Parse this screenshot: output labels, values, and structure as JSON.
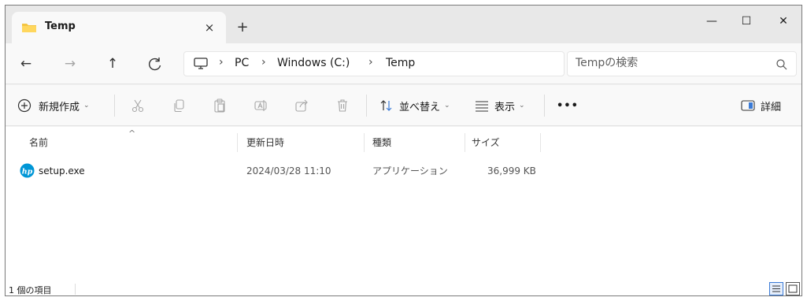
{
  "tab": {
    "title": "Temp",
    "close_glyph": "×",
    "new_tab_glyph": "+",
    "icon": "folder-icon"
  },
  "window_controls": {
    "minimize": "—",
    "maximize": "☐",
    "close": "✕"
  },
  "nav": {
    "back": "←",
    "forward": "→",
    "up": "↑",
    "refresh": "C",
    "breadcrumbs": [
      "PC",
      "Windows (C:)",
      "Temp"
    ],
    "separator": "›"
  },
  "search": {
    "placeholder": "Tempの検索"
  },
  "commands": {
    "new": "新規作成",
    "sort": "並べ替え",
    "view": "表示",
    "more": "•••",
    "details": "詳細"
  },
  "columns": {
    "name": "名前",
    "modified": "更新日時",
    "type": "種類",
    "size": "サイズ"
  },
  "files": [
    {
      "name": "setup.exe",
      "modified": "2024/03/28 11:10",
      "type": "アプリケーション",
      "size": "36,999 KB",
      "icon": "hp-app-icon"
    }
  ],
  "status": {
    "item_count": "1 個の項目"
  },
  "colors": {
    "folder": "#f4c542",
    "hp_blue": "#0096d6",
    "accent": "#3b7bd6"
  }
}
